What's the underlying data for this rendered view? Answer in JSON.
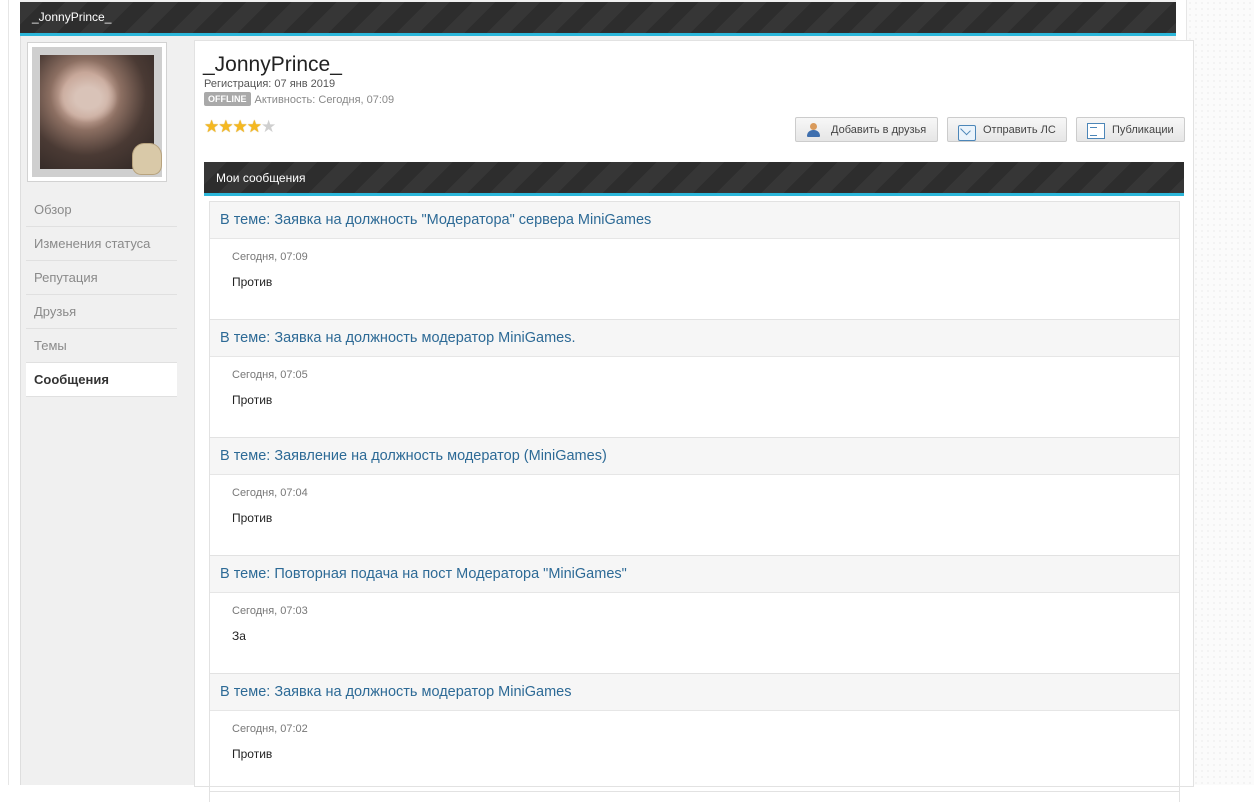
{
  "top_bar": {
    "title": "_JonnyPrince_"
  },
  "profile": {
    "name": "_JonnyPrince_",
    "registration": "Регистрация: 07 янв 2019",
    "status_badge": "OFFLINE",
    "activity": "Активность: Сегодня, 07:09",
    "rating": {
      "filled": 4,
      "total": 5
    }
  },
  "actions": {
    "add_friend": "Добавить в друзья",
    "send_pm": "Отправить ЛС",
    "publications": "Публикации"
  },
  "sidebar": {
    "items": [
      {
        "label": "Обзор",
        "active": false
      },
      {
        "label": "Изменения статуса",
        "active": false
      },
      {
        "label": "Репутация",
        "active": false
      },
      {
        "label": "Друзья",
        "active": false
      },
      {
        "label": "Темы",
        "active": false
      },
      {
        "label": "Сообщения",
        "active": true
      }
    ]
  },
  "section": {
    "title": "Мои сообщения"
  },
  "posts": [
    {
      "topic": "В теме: Заявка на должность \"Модератора\" сервера MiniGames",
      "time": "Сегодня, 07:09",
      "text": "Против"
    },
    {
      "topic": "В теме: Заявка на должность модератор MiniGames.",
      "time": "Сегодня, 07:05",
      "text": "Против"
    },
    {
      "topic": "В теме: Заявление на должность модератор (MiniGames)",
      "time": "Сегодня, 07:04",
      "text": "Против"
    },
    {
      "topic": "В теме: Повторная подача на пост Модератора \"MiniGames\"",
      "time": "Сегодня, 07:03",
      "text": "За"
    },
    {
      "topic": "В теме: Заявка на должность модератор MiniGames",
      "time": "Сегодня, 07:02",
      "text": "Против"
    }
  ],
  "colors": {
    "accent": "#2bb6d9",
    "link": "#2d6a96",
    "header_dark": "#2f2f2f"
  }
}
